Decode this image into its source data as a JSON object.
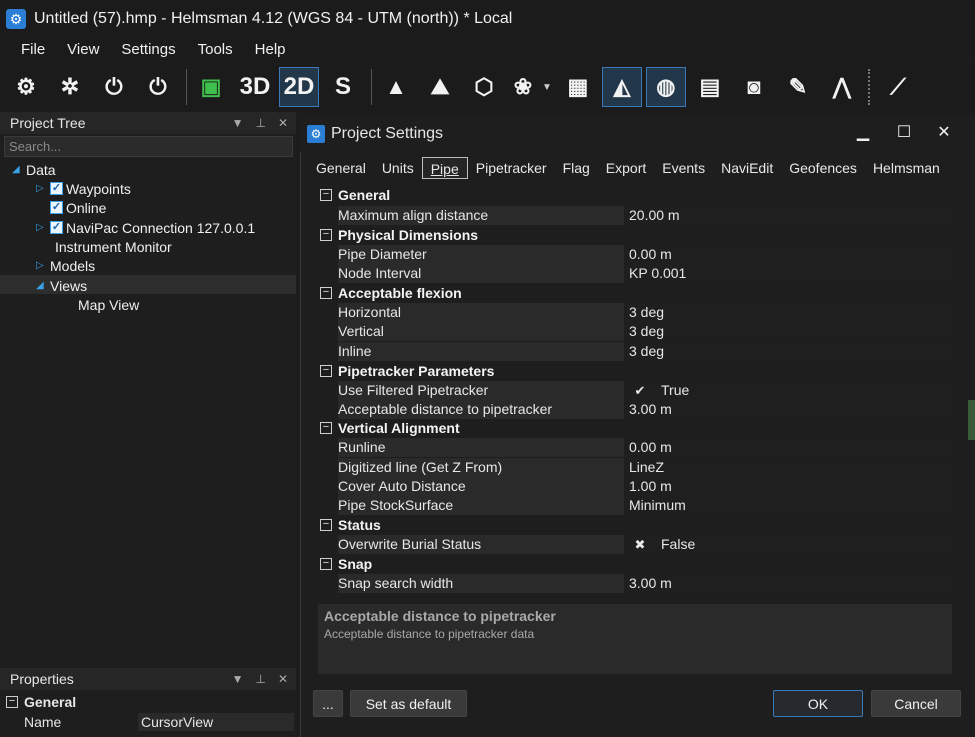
{
  "window": {
    "title": "Untitled (57).hmp - Helmsman 4.12 (WGS 84 - UTM (north)) * Local"
  },
  "menu": [
    "File",
    "View",
    "Settings",
    "Tools",
    "Help"
  ],
  "toolbar": {
    "btn_3d": "3D",
    "btn_2d": "2D",
    "btn_s": "S"
  },
  "project_tree": {
    "title": "Project Tree",
    "search_placeholder": "Search...",
    "nodes": {
      "data": "Data",
      "waypoints": "Waypoints",
      "online": "Online",
      "navipac": "NaviPac Connection 127.0.0.1",
      "instrument": "Instrument Monitor",
      "models": "Models",
      "views": "Views",
      "mapview": "Map View"
    }
  },
  "properties": {
    "title": "Properties",
    "category": "General",
    "name_label": "Name",
    "name_value": "CursorView"
  },
  "dialog": {
    "title": "Project Settings",
    "tabs": [
      "General",
      "Units",
      "Pipe",
      "Pipetracker",
      "Flag",
      "Export",
      "Events",
      "NaviEdit",
      "Geofences",
      "Helmsman"
    ],
    "active_tab": "Pipe",
    "grid": {
      "general": "General",
      "max_align_name": "Maximum align distance",
      "max_align_val": "20.00 m",
      "physical": "Physical Dimensions",
      "pipe_diam_name": "Pipe Diameter",
      "pipe_diam_val": "0.00 m",
      "node_int_name": "Node Interval",
      "node_int_val": "KP 0.001",
      "flexion": "Acceptable flexion",
      "horiz_name": "Horizontal",
      "horiz_val": "3 deg",
      "vert_name": "Vertical",
      "vert_val": "3 deg",
      "inline_name": "Inline",
      "inline_val": "3 deg",
      "pt_params": "Pipetracker Parameters",
      "use_filt_name": "Use Filtered Pipetracker",
      "use_filt_val": "True",
      "acc_dist_name": "Acceptable distance to pipetracker",
      "acc_dist_val": "3.00 m",
      "vert_align": "Vertical Alignment",
      "runline_name": "Runline",
      "runline_val": "0.00 m",
      "digit_name": "Digitized line (Get Z From)",
      "digit_val": "LineZ",
      "cover_name": "Cover Auto Distance",
      "cover_val": "1.00 m",
      "stock_name": "Pipe StockSurface",
      "stock_val": "Minimum",
      "status": "Status",
      "overwrite_name": "Overwrite Burial Status",
      "overwrite_val": "False",
      "snap": "Snap",
      "snap_w_name": "Snap search width",
      "snap_w_val": "3.00 m"
    },
    "description": {
      "title": "Acceptable distance to pipetracker",
      "text": "Acceptable distance to pipetracker data"
    },
    "buttons": {
      "more": "...",
      "set_default": "Set as default",
      "ok": "OK",
      "cancel": "Cancel"
    }
  }
}
